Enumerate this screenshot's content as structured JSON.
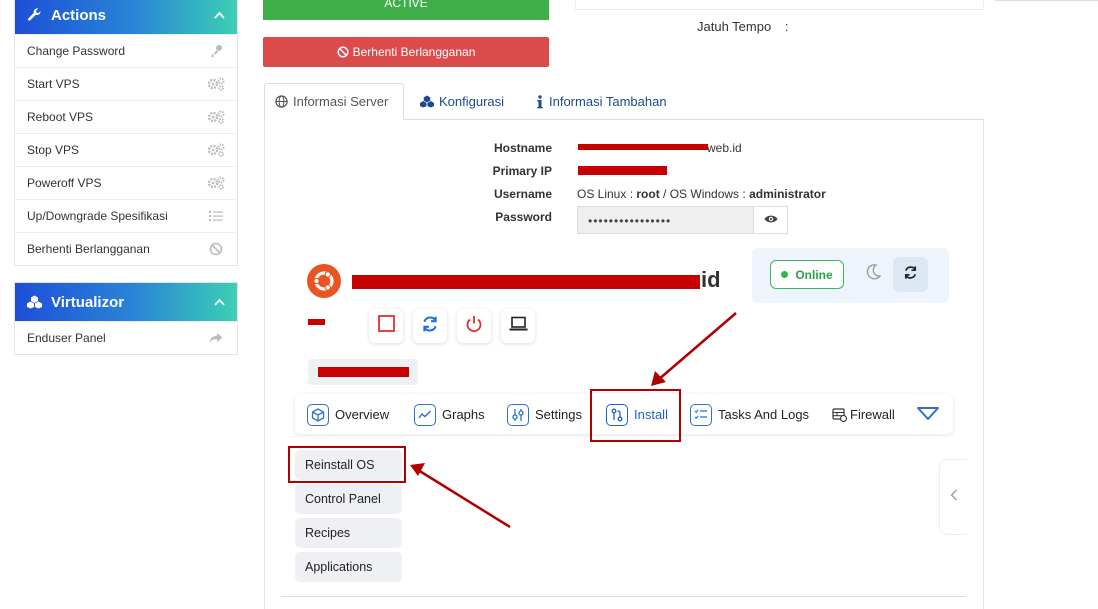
{
  "sidebar": {
    "actions": {
      "title": "Actions",
      "items": [
        {
          "label": "Change Password",
          "icon": "key-icon"
        },
        {
          "label": "Start VPS",
          "icon": "gears-icon"
        },
        {
          "label": "Reboot VPS",
          "icon": "gears-icon"
        },
        {
          "label": "Stop VPS",
          "icon": "gears-icon"
        },
        {
          "label": "Poweroff VPS",
          "icon": "gears-icon"
        },
        {
          "label": "Up/Downgrade Spesifikasi",
          "icon": "list-icon"
        },
        {
          "label": "Berhenti Berlangganan",
          "icon": "ban-icon"
        }
      ]
    },
    "virtualizor": {
      "title": "Virtualizor",
      "items": [
        {
          "label": "Enduser Panel",
          "icon": "share-icon"
        }
      ]
    }
  },
  "status": {
    "active_label": "ACTIVE",
    "stop_label": "Berhenti Berlangganan",
    "due_label": "Jatuh Tempo",
    "due_sep": ":"
  },
  "tabs": [
    {
      "label": "Informasi Server",
      "active": true
    },
    {
      "label": "Konfigurasi",
      "active": false
    },
    {
      "label": "Informasi Tambahan",
      "active": false
    }
  ],
  "server": {
    "hostname_label": "Hostname",
    "hostname_suffix": "web.id",
    "ip_label": "Primary IP",
    "username_label": "Username",
    "username_prefix": "OS Linux : ",
    "username_linux": "root",
    "username_mid": " / OS Windows : ",
    "username_windows": "administrator",
    "password_label": "Password",
    "password_mask": "••••••••••••••••"
  },
  "vps": {
    "host_suffix": "id",
    "status_label": "Online"
  },
  "nav": [
    {
      "label": "Overview",
      "icon": "cube-icon"
    },
    {
      "label": "Graphs",
      "icon": "graph-icon"
    },
    {
      "label": "Settings",
      "icon": "sliders-icon"
    },
    {
      "label": "Install",
      "icon": "git-icon",
      "active": true
    },
    {
      "label": "Tasks And Logs",
      "icon": "tasks-icon"
    },
    {
      "label": "Firewall",
      "icon": "firewall-icon"
    }
  ],
  "install_menu": [
    "Reinstall OS",
    "Control Panel",
    "Recipes",
    "Applications"
  ],
  "colors": {
    "accent_blue": "#1d5fcf",
    "active_green": "#3fae49",
    "stop_red": "#dc4b4b",
    "annotation_red": "#b10000",
    "online_green": "#2f9e4b"
  }
}
